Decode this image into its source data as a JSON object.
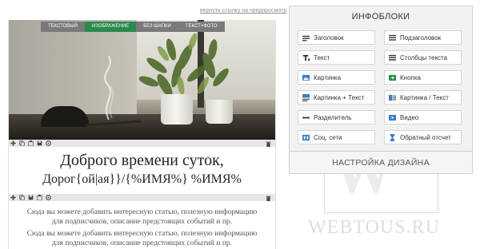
{
  "top_link": "вернуть ссылку на предпросмотр",
  "tabs": [
    {
      "label": "ТЕКСТОВЫЙ",
      "active": false
    },
    {
      "label": "ИЗОБРАЖЕНИЕ",
      "active": true
    },
    {
      "label": "БЕЗ ШАПКИ",
      "active": false
    },
    {
      "label": "ТЕКСТ+ФОТО",
      "active": false
    }
  ],
  "greeting": {
    "line1": "Доброго времени суток,",
    "line2": "Дорог{ой|ая}}/{%ИМЯ%} %ИМЯ%"
  },
  "body": {
    "p1_l1": "Сюда вы можете добавить интересную статью, полезную информацию",
    "p1_l2": "для подписчиков, описание предстоящих событий и пр.",
    "p2_l1": "Сюда вы можете добавить интересную статью, полезную информацию",
    "p2_l2": "для подписчиков, описание предстоящих событий и пр."
  },
  "panel": {
    "title": "ИНФОБЛОКИ",
    "buttons": [
      {
        "label": "Заголовок",
        "icon": "heading-icon"
      },
      {
        "label": "Подзаголовок",
        "icon": "subheading-icon"
      },
      {
        "label": "Текст",
        "icon": "text-icon"
      },
      {
        "label": "Столбцы текста",
        "icon": "text-columns-icon"
      },
      {
        "label": "Картинка",
        "icon": "image-icon"
      },
      {
        "label": "Кнопка",
        "icon": "button-icon"
      },
      {
        "label": "Картинка + Текст",
        "icon": "image-text-icon"
      },
      {
        "label": "Картинка / Текст",
        "icon": "image-slash-text-icon"
      },
      {
        "label": "Разделитель",
        "icon": "divider-icon"
      },
      {
        "label": "Видео",
        "icon": "video-icon"
      },
      {
        "label": "Соц. сети",
        "icon": "social-icon"
      },
      {
        "label": "Обратный отсчет",
        "icon": "hourglass-icon"
      }
    ],
    "design_label": "НАСТРОЙКА ДИЗАЙНА"
  },
  "watermark": {
    "letter": "W",
    "text": "WEBTOUS.RU"
  },
  "colors": {
    "active_tab": "#2a8a4d",
    "tab": "#7a7a7a",
    "icon_blue": "#3b7fc4",
    "icon_green": "#2a8a4d"
  }
}
